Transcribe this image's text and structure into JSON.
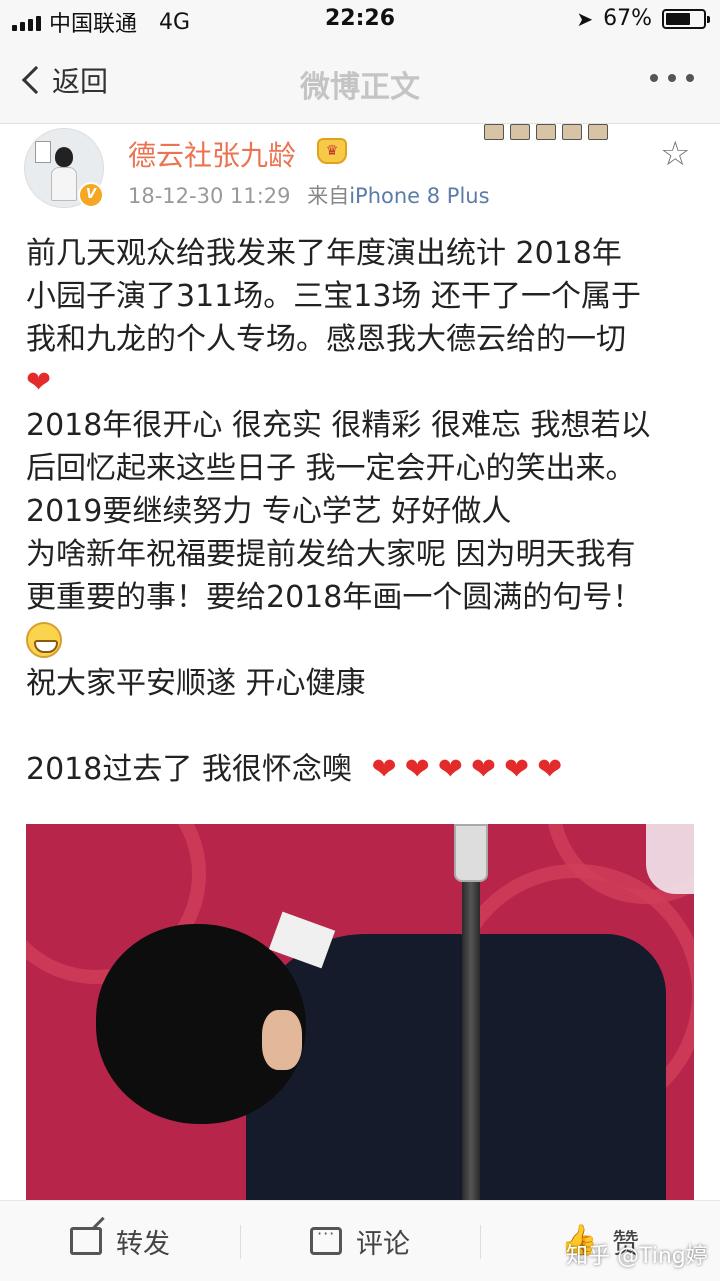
{
  "status_bar": {
    "carrier": "中国联通",
    "network": "4G",
    "time": "22:26",
    "battery": "67%",
    "battery_level": 0.67
  },
  "nav": {
    "back_label": "返回",
    "title": "微博正文"
  },
  "post": {
    "author": "德云社张九龄",
    "timestamp": "18-12-30 11:29",
    "source_prefix": "来自",
    "source_device": "iPhone 8 Plus",
    "lines": [
      "前几天观众给我发来了年度演出统计 2018年",
      "小园子演了311场。三宝13场 还干了一个属于",
      "我和九龙的个人专场。感恩我大德云给的一切",
      "2018年很开心 很充实 很精彩 很难忘 我想若以",
      "后回忆起来这些日子 我一定会开心的笑出来。",
      "2019要继续努力 专心学艺 好好做人",
      "为啥新年祝福要提前发给大家呢 因为明天我有",
      "更重要的事！要给2018年画一个圆满的句号！",
      "祝大家平安顺遂 开心健康",
      "2018过去了 我很怀念噢"
    ],
    "hearts_count": 6
  },
  "actions": {
    "repost": "转发",
    "comment": "评论",
    "like": "赞"
  },
  "watermark": "知乎 @Ting婷",
  "icons": {
    "heart": "❤",
    "star": "☆",
    "like": "👍"
  }
}
